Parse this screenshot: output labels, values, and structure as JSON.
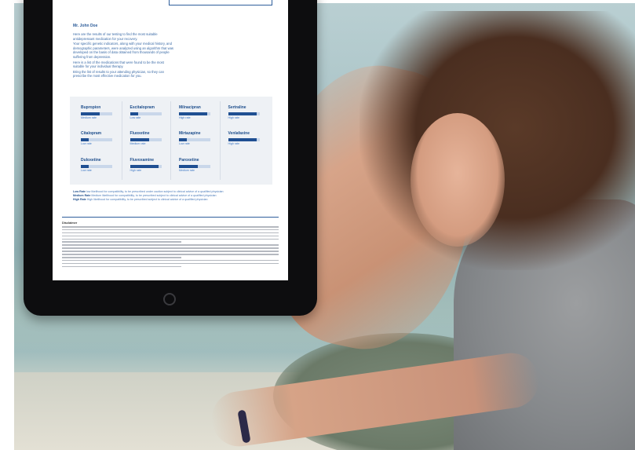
{
  "screen": {
    "greeting": "Mr. John Doe",
    "intro_paragraphs": [
      "Here are the results of our testing to find the most suitable antidepressant medication for your recovery.",
      "Your specific genetic indicators, along with your medical history, and demographic parameters, were analyzed using an algorithm that was developed on the basis of data obtained from thousands of people suffering from depression.",
      "Here is a list of the medications that were found to be the most suitable for your individual therapy.",
      "Bring the list of results to your attending physician, so they can prescribe the most effective medication for you."
    ],
    "medications": [
      {
        "name": "Bupropion",
        "rate": "Medium rate",
        "level": 0.6
      },
      {
        "name": "Escitalopram",
        "rate": "Low rate",
        "level": 0.25
      },
      {
        "name": "Milnacipran",
        "rate": "High rate",
        "level": 0.9
      },
      {
        "name": "Sertraline",
        "rate": "High rate",
        "level": 0.9
      },
      {
        "name": "Citalopram",
        "rate": "Low rate",
        "level": 0.25
      },
      {
        "name": "Fluoxetine",
        "rate": "Medium rate",
        "level": 0.6
      },
      {
        "name": "Mirtazapine",
        "rate": "Low rate",
        "level": 0.25
      },
      {
        "name": "Venlafaxine",
        "rate": "High rate",
        "level": 0.9
      },
      {
        "name": "Duloxetine",
        "rate": "Low rate",
        "level": 0.25
      },
      {
        "name": "Fluvoxamine",
        "rate": "High rate",
        "level": 0.9
      },
      {
        "name": "Paroxetine",
        "rate": "Medium rate",
        "level": 0.6
      }
    ],
    "legend": [
      {
        "label": "Low Rate",
        "text": "low likelihood for compatibility, to be prescribed under caution subject to clinical advice of a qualified physician"
      },
      {
        "label": "Medium Rate",
        "text": "Medium likelihood for compatibility, to be prescribed subject to clinical advice of a qualified physician"
      },
      {
        "label": "High Rate",
        "text": "High likelihood for compatibility, to be prescribed subject to clinical advice of a qualified physician"
      }
    ],
    "disclaimer_title": "Disclaimer"
  },
  "colors": {
    "accent": "#1f4f92",
    "bar_track": "#c9d7ea",
    "rate_text": "#3f78c4"
  }
}
